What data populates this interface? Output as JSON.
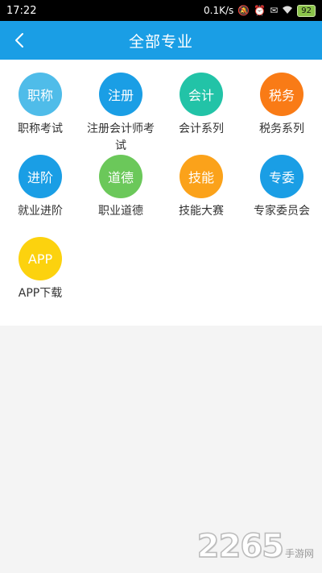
{
  "status_bar": {
    "time": "17:22",
    "speed": "0.1K/s",
    "battery": "92"
  },
  "header": {
    "title": "全部专业"
  },
  "categories": [
    {
      "circle_text": "职称",
      "label": "职称考试",
      "color": "#4fbce9"
    },
    {
      "circle_text": "注册",
      "label": "注册会计师考试",
      "color": "#1a9ee5"
    },
    {
      "circle_text": "会计",
      "label": "会计系列",
      "color": "#22c3a7"
    },
    {
      "circle_text": "税务",
      "label": "税务系列",
      "color": "#f97b16"
    },
    {
      "circle_text": "进阶",
      "label": "就业进阶",
      "color": "#1a9ee5"
    },
    {
      "circle_text": "道德",
      "label": "职业道德",
      "color": "#6bc85a"
    },
    {
      "circle_text": "技能",
      "label": "技能大赛",
      "color": "#fba21a"
    },
    {
      "circle_text": "专委",
      "label": "专家委员会",
      "color": "#1a9ee5"
    },
    {
      "circle_text": "APP",
      "label": "APP下载",
      "color": "#fcd20e"
    }
  ],
  "watermark": {
    "number": "2265",
    "text": "手游网"
  }
}
